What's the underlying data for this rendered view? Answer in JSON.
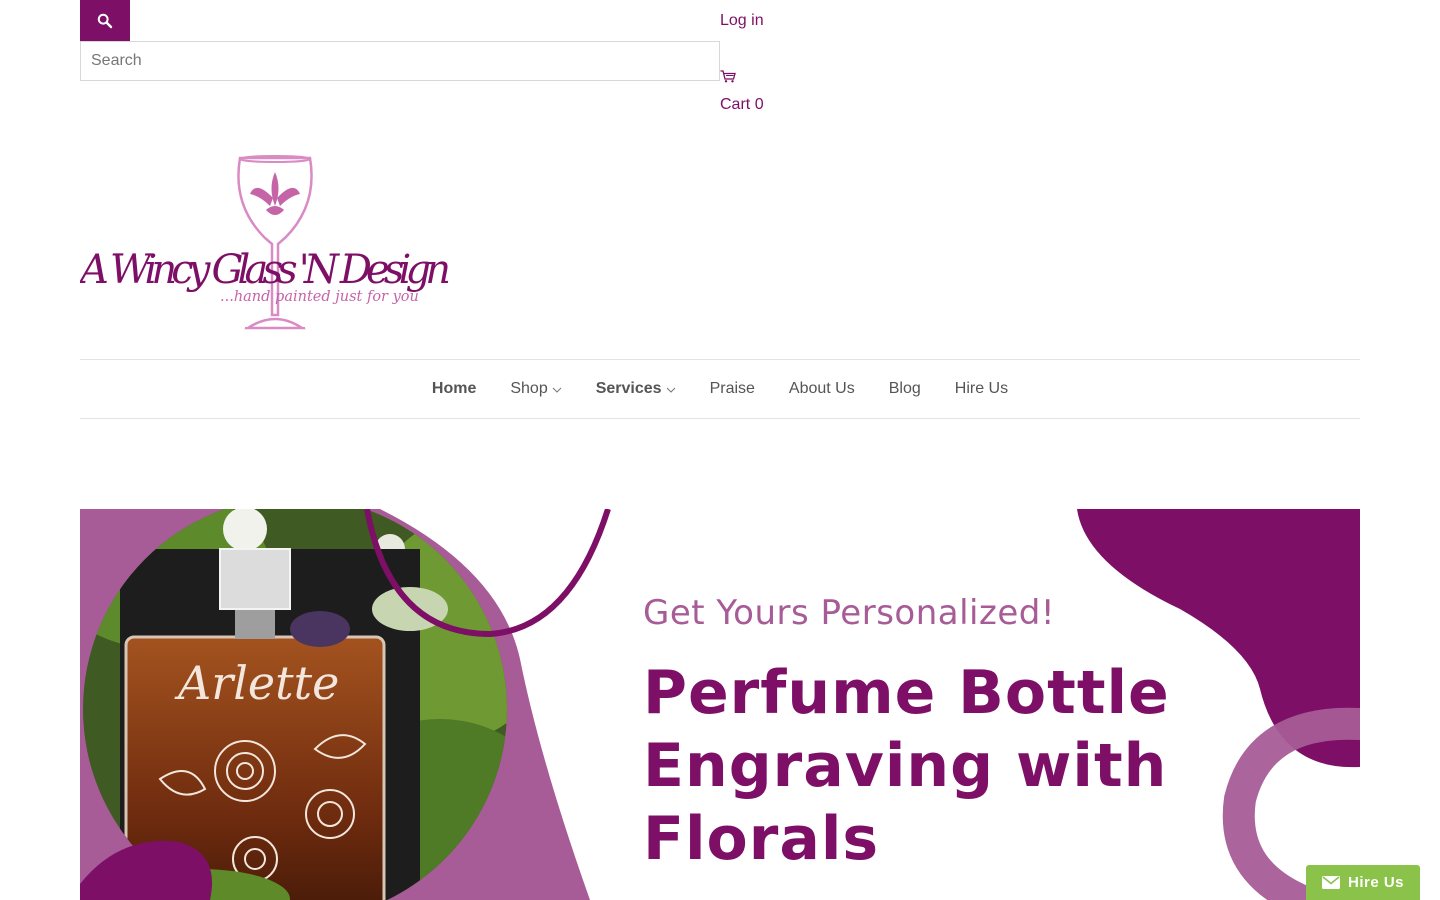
{
  "header": {
    "search": {
      "button_icon": "search-icon",
      "placeholder": "Search"
    },
    "login_label": "Log in",
    "cart": {
      "icon": "cart-icon",
      "label": "Cart",
      "count": "0"
    }
  },
  "logo": {
    "brand_text": "A Wincy Glass 'N Design",
    "tagline": "...hand painted just for you"
  },
  "nav": {
    "items": [
      {
        "label": "Home",
        "active": true,
        "dropdown": false
      },
      {
        "label": "Shop",
        "active": false,
        "dropdown": true
      },
      {
        "label": "Services",
        "active": true,
        "dropdown": true
      },
      {
        "label": "Praise",
        "active": false,
        "dropdown": false
      },
      {
        "label": "About Us",
        "active": false,
        "dropdown": false
      },
      {
        "label": "Blog",
        "active": false,
        "dropdown": false
      },
      {
        "label": "Hire Us",
        "active": false,
        "dropdown": false
      }
    ]
  },
  "hero": {
    "subtitle": "Get Yours Personalized!",
    "title_lines": [
      "Perfume Bottle",
      "Engraving with",
      "Florals"
    ],
    "bottle_engraving": "Arlette"
  },
  "hire_tab": {
    "icon": "envelope-icon",
    "label": "Hire Us"
  },
  "colors": {
    "brand_purple": "#7d0f66",
    "light_purple": "#a85c97",
    "pink": "#d98bc4",
    "hire_green": "#8bc34a"
  }
}
